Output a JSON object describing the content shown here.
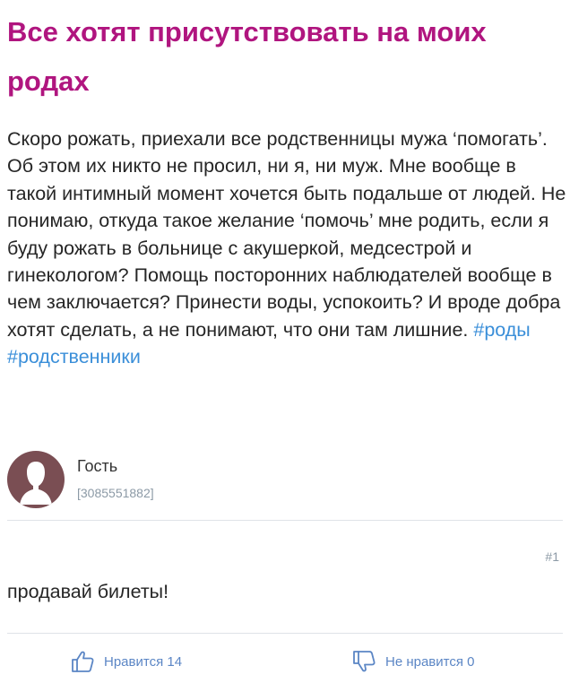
{
  "post": {
    "title": "Все хотят присутствовать на моих родах",
    "body": "Скоро рожать, приехали все родственницы мужа ‘помогать’. Об этом их никто не просил, ни я, ни муж. Мне вообще в такой интимный момент хочется быть подальше от людей. Не понимаю, откуда такое желание ‘помочь’ мне родить, если я буду рожать в больнице с акушеркой, медсестрой и гинекологом? Помощь посторонних наблюдателей вообще в чем заключается? Принести воды, успокоить? И вроде добра хотят сделать, а не понимают, что они там лишние.",
    "hashtags": [
      "#роды",
      "#родственники"
    ]
  },
  "author": {
    "name": "Гость",
    "id": "[3085551882]",
    "avatar_icon": "user-silhouette-icon",
    "avatar_color": "#7a4e53"
  },
  "reply": {
    "number": "#1",
    "text": "продавай билеты!"
  },
  "votes": {
    "like_label": "Нравится 14",
    "dislike_label": "Не нравится 0",
    "like_icon": "thumbs-up-icon",
    "dislike_icon": "thumbs-down-icon"
  },
  "colors": {
    "title": "#b0157f",
    "hashtag": "#3b8fd9",
    "vote_label": "#5b86c5",
    "muted": "#8c9aa6"
  }
}
